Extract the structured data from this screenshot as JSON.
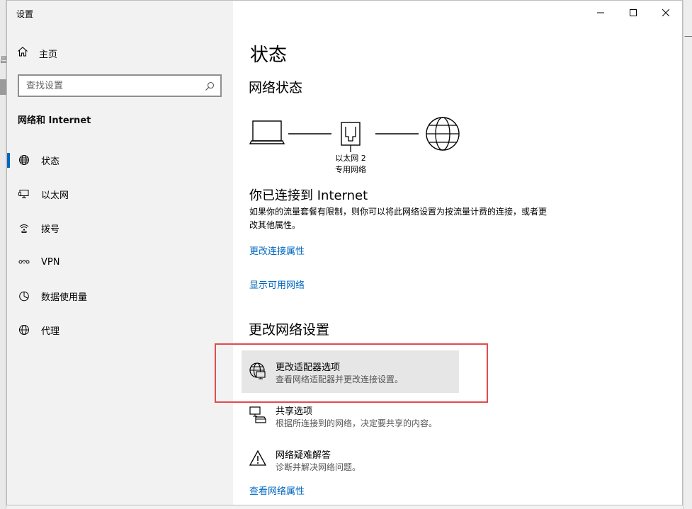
{
  "window": {
    "title": "设置",
    "minimize_label": "minimize",
    "maximize_label": "maximize",
    "close_label": "close"
  },
  "background": {
    "fragment_1": "—",
    "fragment_2": "昌"
  },
  "sidebar": {
    "home_label": "主页",
    "search_placeholder": "查找设置",
    "section_title": "网络和 Internet",
    "items": [
      {
        "label": "状态",
        "icon": "globe-icon",
        "active": true
      },
      {
        "label": "以太网",
        "icon": "ethernet-monitor-icon",
        "active": false
      },
      {
        "label": "拨号",
        "icon": "dialup-icon",
        "active": false
      },
      {
        "label": "VPN",
        "icon": "vpn-icon",
        "active": false
      },
      {
        "label": "数据使用量",
        "icon": "data-usage-icon",
        "active": false
      },
      {
        "label": "代理",
        "icon": "globe-icon",
        "active": false
      }
    ]
  },
  "content": {
    "page_title": "状态",
    "network_status_title": "网络状态",
    "diagram": {
      "adapter_name": "以太网 2",
      "network_type": "专用网络"
    },
    "connected_title": "你已连接到 Internet",
    "connected_desc": "如果你的流量套餐有限制，则你可以将此网络设置为按流量计费的连接，或者更改其他属性。",
    "link_change_connection": "更改连接属性",
    "link_show_networks": "显示可用网络",
    "change_settings_title": "更改网络设置",
    "options": [
      {
        "title": "更改适配器选项",
        "desc": "查看网络适配器并更改连接设置。",
        "icon": "adapter-globe-icon",
        "highlighted": true
      },
      {
        "title": "共享选项",
        "desc": "根据所连接到的网络，决定要共享的内容。",
        "icon": "sharing-icon",
        "highlighted": false
      },
      {
        "title": "网络疑难解答",
        "desc": "诊断并解决网络问题。",
        "icon": "warning-icon",
        "highlighted": false
      }
    ],
    "link_view_properties": "查看网络属性"
  },
  "colors": {
    "accent": "#0067c0",
    "highlight_border": "#e24b4b",
    "sidebar_bg": "#f2f2f2",
    "option_highlight_bg": "#e6e6e6"
  }
}
